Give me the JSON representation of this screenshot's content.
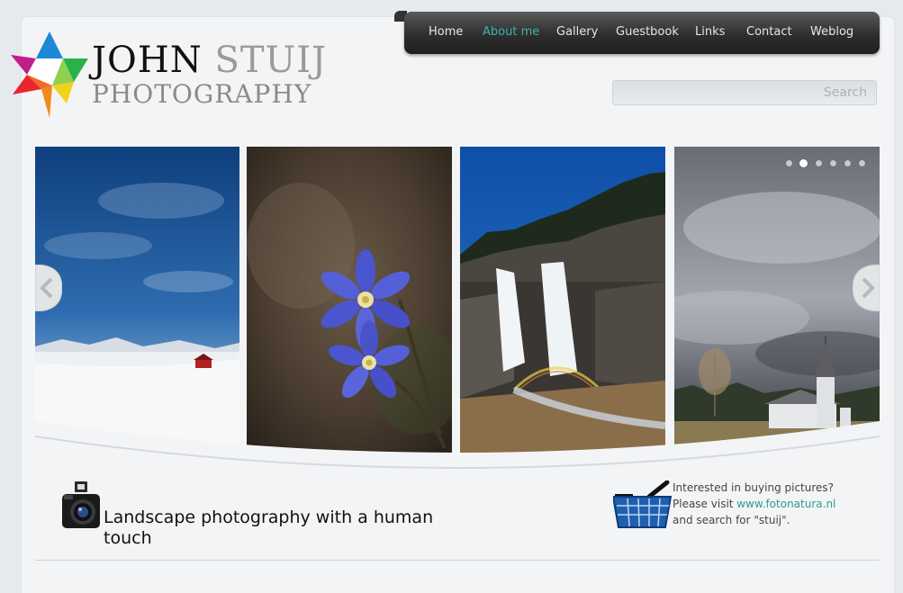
{
  "brand": {
    "name_first": "JOHN",
    "name_last": "STUIJ",
    "subtitle": "PHOTOGRAPHY"
  },
  "nav": {
    "items": [
      {
        "label": "Home",
        "active": false
      },
      {
        "label": "About me",
        "active": true
      },
      {
        "label": "Gallery",
        "active": false
      },
      {
        "label": "Guestbook",
        "active": false
      },
      {
        "label": "Links",
        "active": false
      },
      {
        "label": "Contact",
        "active": false
      },
      {
        "label": "Weblog",
        "active": false
      }
    ],
    "active_color": "#3bb5a8"
  },
  "search": {
    "placeholder": "Search"
  },
  "slider": {
    "slides": [
      {
        "subject": "snowy landscape with red cabin"
      },
      {
        "subject": "blue hepatica flowers"
      },
      {
        "subject": "waterfall with rainbow"
      },
      {
        "subject": "white church under storm clouds"
      }
    ],
    "dot_count": 6,
    "active_dot": 1
  },
  "tagline": "Landscape photography with a human touch",
  "buy": {
    "line1": "Interested in buying pictures?",
    "line2_prefix": "Please visit ",
    "link_text": "www.fotonatura.nl",
    "line3": "and search for \"stuij\"."
  },
  "icons": {
    "logo": "star-logo-icon",
    "camera": "camera-icon",
    "basket": "shopping-basket-icon",
    "prev": "chevron-left-icon",
    "next": "chevron-right-icon"
  }
}
